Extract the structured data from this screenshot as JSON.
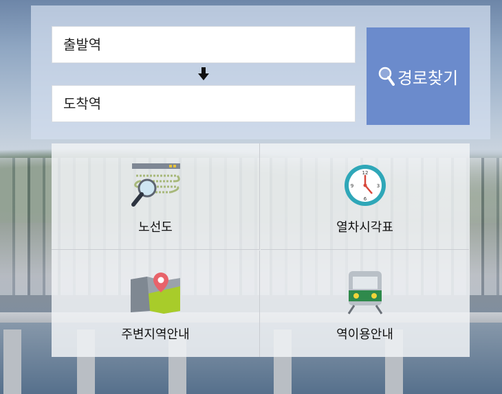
{
  "route_search": {
    "departure_placeholder": "출발역",
    "arrival_placeholder": "도착역",
    "search_label": "경로찾기"
  },
  "menu": {
    "route_map": "노선도",
    "timetable": "열차시각표",
    "nearby": "주변지역안내",
    "station_guide": "역이용안내"
  },
  "icons": {
    "swap": "arrow-down-icon",
    "search": "magnifier-icon",
    "route_map": "route-map-magnifier-icon",
    "timetable": "clock-icon",
    "nearby": "map-pin-icon",
    "station_guide": "train-icon"
  },
  "colors": {
    "search_button": "#6b8bcc",
    "clock_teal": "#2fa7b8",
    "map_pin": "#e8636a",
    "map_green": "#a8cc2a"
  }
}
